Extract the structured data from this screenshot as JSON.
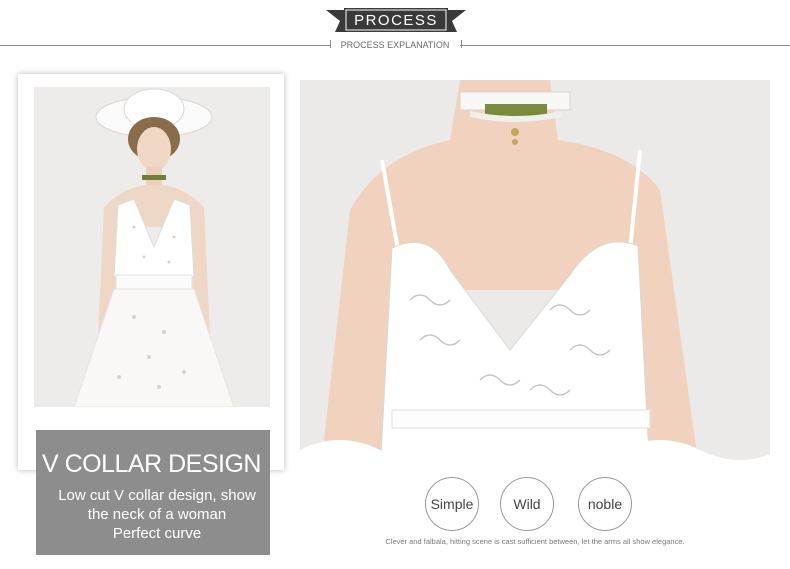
{
  "header": {
    "title": "PROCESS",
    "subtitle": "PROCESS EXPLANATION",
    "banner_color": "#3a3a3a"
  },
  "left_card": {
    "photo": "woman-in-white-dress-and-hat-photo"
  },
  "feature": {
    "title": "V COLLAR DESIGN",
    "description_lines": [
      "Low cut V collar design, show",
      "the neck of a woman",
      "Perfect curve"
    ],
    "box_color": "#8d8d8d"
  },
  "detail": {
    "photo": "close-up-v-neck-and-choker-photo"
  },
  "tags": [
    "Simple",
    "Wild",
    "noble"
  ],
  "footer_note": "Clever and falbala, hitting scene is cast sufficient between, let the arms all show elegance."
}
